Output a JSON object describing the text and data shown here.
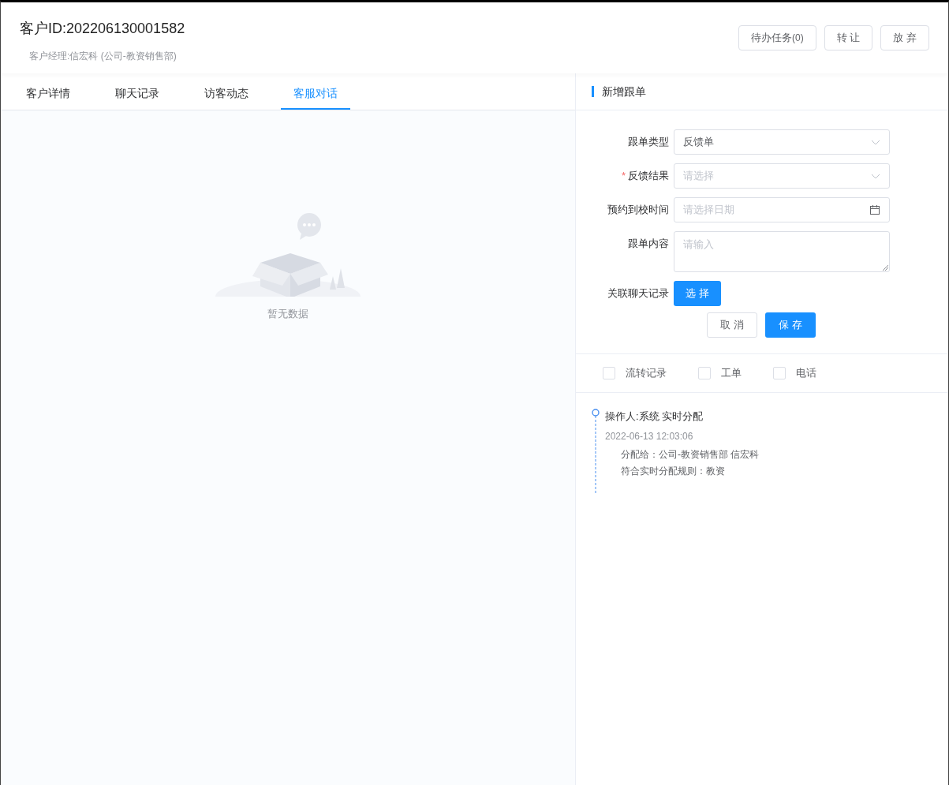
{
  "header": {
    "title": "客户ID:202206130001582",
    "subtitle": "客户经理:信宏科 (公司-教资销售部)",
    "buttons": [
      {
        "label": "待办任务",
        "count": "(0)"
      },
      {
        "label": "转 让"
      },
      {
        "label": "放 弃"
      }
    ]
  },
  "tabs": [
    {
      "label": "客户详情",
      "selected": false
    },
    {
      "label": "聊天记录",
      "selected": false
    },
    {
      "label": "访客动态",
      "selected": false
    },
    {
      "label": "客服对话",
      "selected": true
    }
  ],
  "empty_state": {
    "text": "暂无数据"
  },
  "form": {
    "title": "新增跟单",
    "fields": [
      {
        "kind": "select",
        "label": "跟单类型",
        "value": "反馈单"
      },
      {
        "kind": "select",
        "label": "反馈结果",
        "required_mark": "*",
        "placeholder": "请选择"
      },
      {
        "kind": "date",
        "label": "预约到校时间",
        "placeholder": "请选择日期"
      },
      {
        "kind": "textarea",
        "label": "跟单内容",
        "placeholder": "请输入"
      },
      {
        "kind": "button",
        "label": "关联聊天记录",
        "button": "选 择"
      }
    ],
    "actions": [
      {
        "label": "取 消",
        "primary": false
      },
      {
        "label": "保 存",
        "primary": true
      }
    ]
  },
  "filters": [
    {
      "label": "流转记录",
      "checked": false
    },
    {
      "label": "工单",
      "checked": false
    },
    {
      "label": "电话",
      "checked": false
    }
  ],
  "timeline": [
    {
      "title": "操作人:系统 实时分配",
      "time": "2022-06-13 12:03:06",
      "lines": [
        "分配给：公司-教资销售部 信宏科",
        "符合实时分配规则：教资"
      ]
    }
  ]
}
